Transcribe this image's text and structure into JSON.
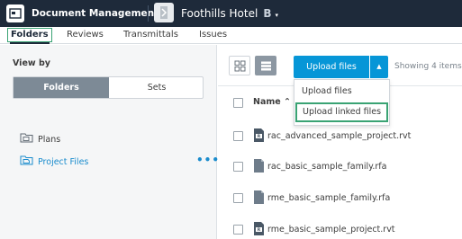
{
  "topbar": {
    "module": "Document Management",
    "project": "Foothills Hotel",
    "project_badge": "B",
    "caret": "▾"
  },
  "tabs": [
    {
      "label": "Folders",
      "active": true
    },
    {
      "label": "Reviews",
      "active": false
    },
    {
      "label": "Transmittals",
      "active": false
    },
    {
      "label": "Issues",
      "active": false
    }
  ],
  "left_panel": {
    "view_by_label": "View by",
    "toggle": {
      "folders": "Folders",
      "sets": "Sets"
    },
    "tree": {
      "plans": "Plans",
      "project_files": "Project Files",
      "more": "•••"
    }
  },
  "toolbar": {
    "upload_label": "Upload files",
    "upload_caret": "▲",
    "showing": "Showing 4 items"
  },
  "upload_menu": {
    "items": [
      "Upload files",
      "Upload linked files"
    ],
    "highlighted": "Upload linked files"
  },
  "table": {
    "header_name": "Name ⌃",
    "rows": [
      {
        "name": "rac_advanced_sample_project.rvt",
        "icon": "rvt-file-icon"
      },
      {
        "name": "rac_basic_sample_family.rfa",
        "icon": "rfa-file-icon"
      },
      {
        "name": "rme_basic_sample_family.rfa",
        "icon": "rfa-file-icon"
      },
      {
        "name": "rme_basic_sample_project.rvt",
        "icon": "rvt-file-icon"
      }
    ]
  },
  "colors": {
    "topbar_bg": "#1e2a3a",
    "accent_blue": "#0696d7",
    "link_blue": "#1a8ccd",
    "highlight_green": "#3aa374",
    "toggle_active": "#7d8a96"
  }
}
